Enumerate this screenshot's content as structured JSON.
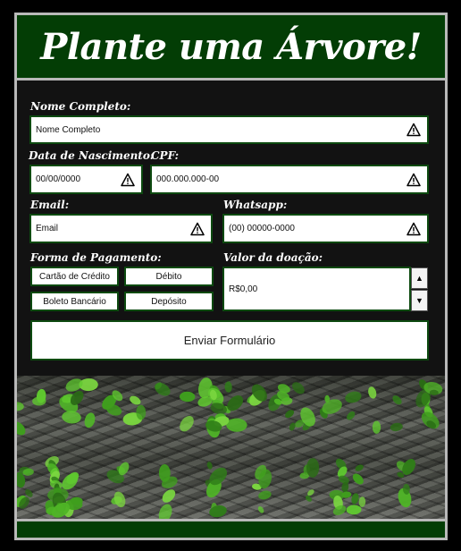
{
  "header": {
    "title": "Plante uma Árvore!"
  },
  "form": {
    "nome": {
      "label": "Nome Completo:",
      "placeholder": "Nome Completo"
    },
    "nascimento": {
      "label": "Data de Nascimento:",
      "placeholder": "00/00/0000"
    },
    "cpf": {
      "label": "CPF:",
      "placeholder": "000.000.000-00"
    },
    "email": {
      "label": "Email:",
      "placeholder": "Email"
    },
    "whatsapp": {
      "label": "Whatsapp:",
      "placeholder": "(00) 00000-0000"
    },
    "pagamento": {
      "label": "Forma de Pagamento:",
      "options": [
        "Cartão de Crédito",
        "Débito",
        "Boleto Bancário",
        "Depósito"
      ]
    },
    "valor": {
      "label": "Valor da doação:",
      "value": "R$0,00"
    },
    "submit_label": "Enviar Formulário"
  },
  "icons": {
    "warning": "warning-icon",
    "spin_up": "arrow-up-icon",
    "spin_down": "arrow-down-icon"
  },
  "colors": {
    "header_bg": "#033d05",
    "form_bg": "#121212",
    "field_border": "#0d4a10",
    "frame": "#b9b9b9",
    "leaf": "#3f9e1d"
  }
}
